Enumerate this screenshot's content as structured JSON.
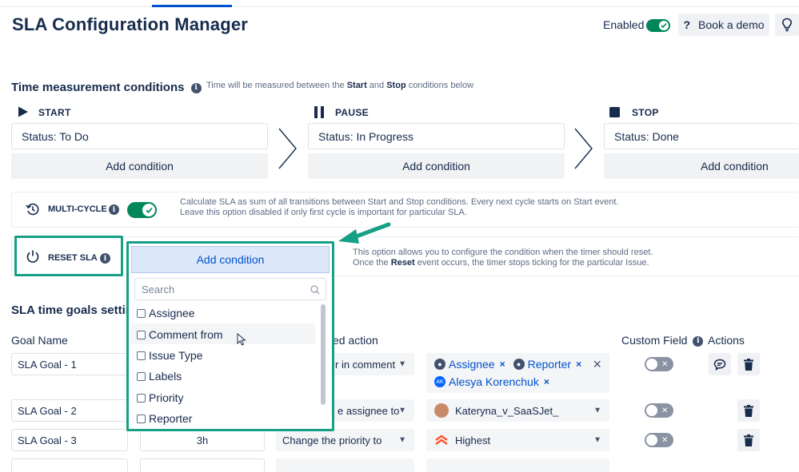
{
  "header": {
    "title": "SLA Configuration Manager",
    "enabled_label": "Enabled",
    "enabled": true,
    "book_demo_label": "Book a demo",
    "help_glyph": "?"
  },
  "time_conditions": {
    "title": "Time measurement conditions",
    "hint_prefix": "Time will be measured between the ",
    "hint_start": "Start",
    "hint_mid": " and ",
    "hint_stop": "Stop",
    "hint_suffix": " conditions below",
    "phases": [
      {
        "label": "START",
        "icon": "play-icon",
        "value": "Status: To Do",
        "add_label": "Add condition"
      },
      {
        "label": "PAUSE",
        "icon": "pause-icon",
        "value": "Status: In Progress",
        "add_label": "Add condition"
      },
      {
        "label": "STOP",
        "icon": "stop-icon",
        "value": "Status: Done",
        "add_label": "Add condition"
      }
    ]
  },
  "multi_cycle": {
    "label": "MULTI-CYCLE",
    "enabled": true,
    "hint_line1": "Calculate SLA as sum of all transitions between Start and Stop conditions. Every next cycle starts on Start event.",
    "hint_line2": "Leave this option disabled if only first cycle is important for particular SLA."
  },
  "reset_sla": {
    "label": "RESET SLA",
    "add_label": "Add condition",
    "hint_line1": "This option allows you to configure the condition when the timer should reset.",
    "hint_line2_prefix": "Once the ",
    "hint_line2_bold": "Reset",
    "hint_line2_suffix": " event occurs, the timer stops ticking for the particular Issue."
  },
  "dropdown": {
    "search_placeholder": "Search",
    "options": [
      "Assignee",
      "Comment from",
      "Issue Type",
      "Labels",
      "Priority",
      "Reporter"
    ]
  },
  "goals": {
    "title": "SLA time goals setting",
    "columns": {
      "goal_name": "Goal Name",
      "action": "ed action",
      "custom_field": "Custom Field",
      "actions": "Actions"
    },
    "rows": [
      {
        "name": "SLA Goal - 1",
        "time": "",
        "action": "r in comment",
        "targets": [
          {
            "label": "Assignee",
            "avatar": "user-icon"
          },
          {
            "label": "Reporter",
            "avatar": "user-icon"
          },
          {
            "label": "Alesya Korenchuk",
            "avatar": "AK"
          }
        ]
      },
      {
        "name": "SLA Goal - 2",
        "time": "",
        "action": "e assignee to",
        "value": "Kateryna_v_SaaSJet_"
      },
      {
        "name": "SLA Goal - 3",
        "time": "3h",
        "action": "Change the priority to",
        "value": "Highest"
      }
    ]
  },
  "colors": {
    "accent": "#0052cc",
    "toggle_on": "#00875a",
    "highlight": "#16a085",
    "priority_highest": "#ff5630"
  }
}
